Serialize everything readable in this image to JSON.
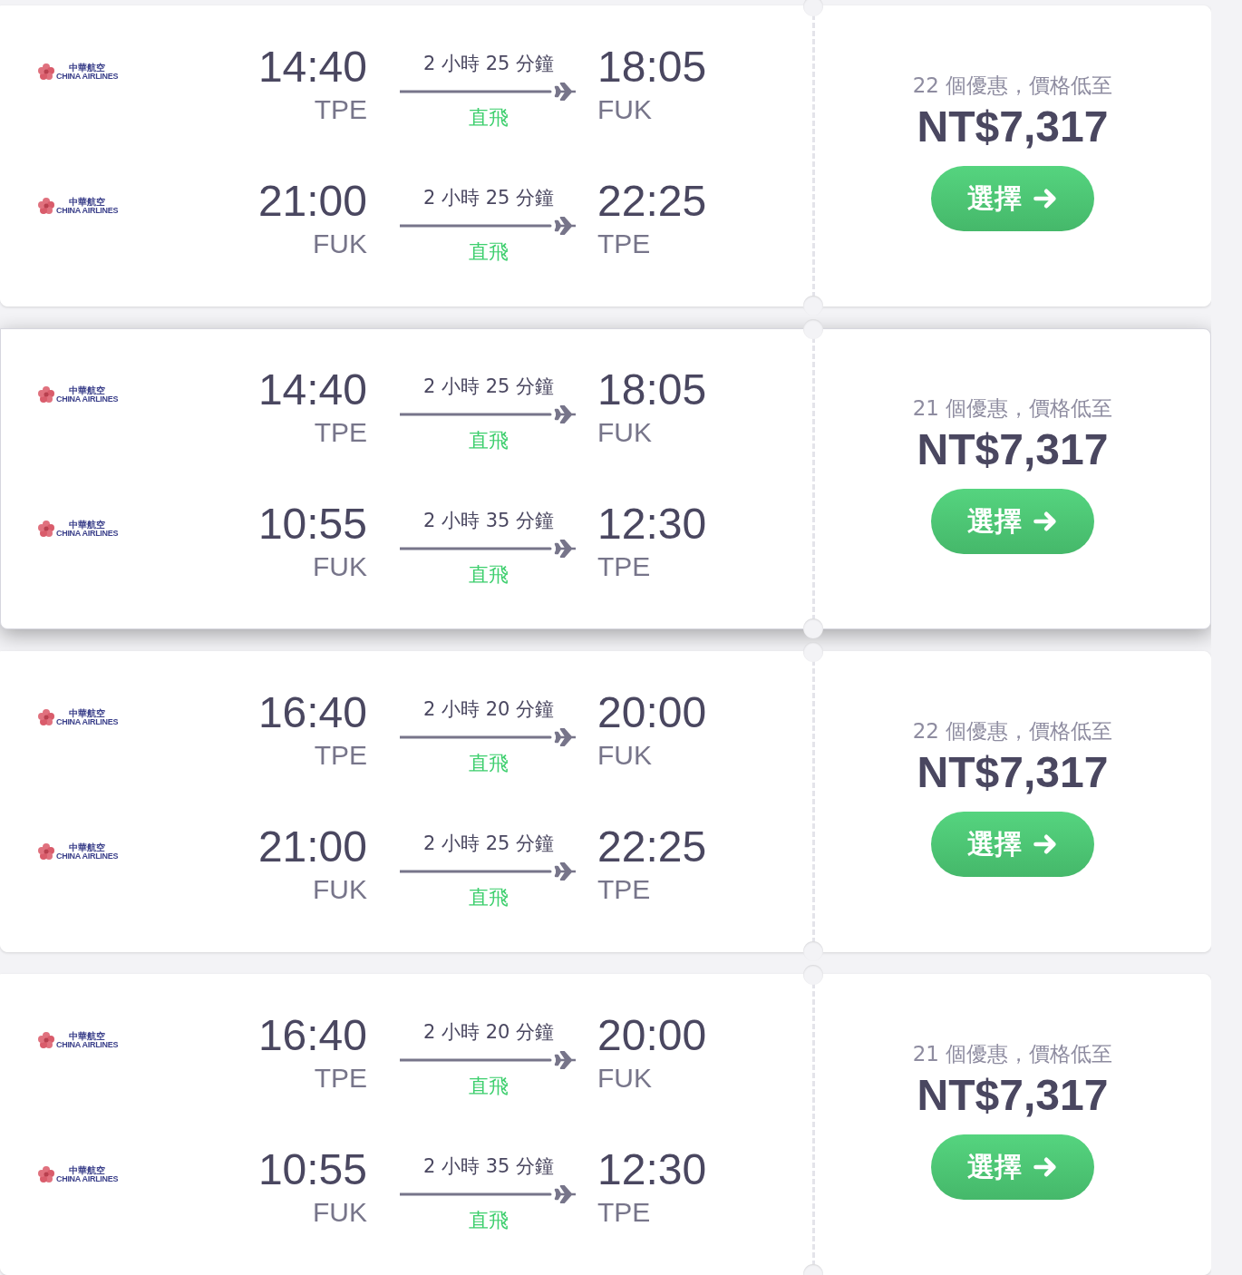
{
  "results": [
    {
      "highlighted": false,
      "legs": [
        {
          "airline": {
            "name_zh": "中華航空",
            "name_en": "CHINA AIRLINES"
          },
          "depart_time": "14:40",
          "depart_code": "TPE",
          "duration": "2 小時 25 分鐘",
          "stops": "直飛",
          "arrive_time": "18:05",
          "arrive_code": "FUK"
        },
        {
          "airline": {
            "name_zh": "中華航空",
            "name_en": "CHINA AIRLINES"
          },
          "depart_time": "21:00",
          "depart_code": "FUK",
          "duration": "2 小時 25 分鐘",
          "stops": "直飛",
          "arrive_time": "22:25",
          "arrive_code": "TPE"
        }
      ],
      "offers": "22 個優惠，價格低至",
      "price": "NT$7,317",
      "button": "選擇"
    },
    {
      "highlighted": true,
      "legs": [
        {
          "airline": {
            "name_zh": "中華航空",
            "name_en": "CHINA AIRLINES"
          },
          "depart_time": "14:40",
          "depart_code": "TPE",
          "duration": "2 小時 25 分鐘",
          "stops": "直飛",
          "arrive_time": "18:05",
          "arrive_code": "FUK"
        },
        {
          "airline": {
            "name_zh": "中華航空",
            "name_en": "CHINA AIRLINES"
          },
          "depart_time": "10:55",
          "depart_code": "FUK",
          "duration": "2 小時 35 分鐘",
          "stops": "直飛",
          "arrive_time": "12:30",
          "arrive_code": "TPE"
        }
      ],
      "offers": "21 個優惠，價格低至",
      "price": "NT$7,317",
      "button": "選擇"
    },
    {
      "highlighted": false,
      "legs": [
        {
          "airline": {
            "name_zh": "中華航空",
            "name_en": "CHINA AIRLINES"
          },
          "depart_time": "16:40",
          "depart_code": "TPE",
          "duration": "2 小時 20 分鐘",
          "stops": "直飛",
          "arrive_time": "20:00",
          "arrive_code": "FUK"
        },
        {
          "airline": {
            "name_zh": "中華航空",
            "name_en": "CHINA AIRLINES"
          },
          "depart_time": "21:00",
          "depart_code": "FUK",
          "duration": "2 小時 25 分鐘",
          "stops": "直飛",
          "arrive_time": "22:25",
          "arrive_code": "TPE"
        }
      ],
      "offers": "22 個優惠，價格低至",
      "price": "NT$7,317",
      "button": "選擇"
    },
    {
      "highlighted": false,
      "legs": [
        {
          "airline": {
            "name_zh": "中華航空",
            "name_en": "CHINA AIRLINES"
          },
          "depart_time": "16:40",
          "depart_code": "TPE",
          "duration": "2 小時 20 分鐘",
          "stops": "直飛",
          "arrive_time": "20:00",
          "arrive_code": "FUK"
        },
        {
          "airline": {
            "name_zh": "中華航空",
            "name_en": "CHINA AIRLINES"
          },
          "depart_time": "10:55",
          "depart_code": "FUK",
          "duration": "2 小時 35 分鐘",
          "stops": "直飛",
          "arrive_time": "12:30",
          "arrive_code": "TPE"
        }
      ],
      "offers": "21 個優惠，價格低至",
      "price": "NT$7,317",
      "button": "選擇"
    }
  ]
}
